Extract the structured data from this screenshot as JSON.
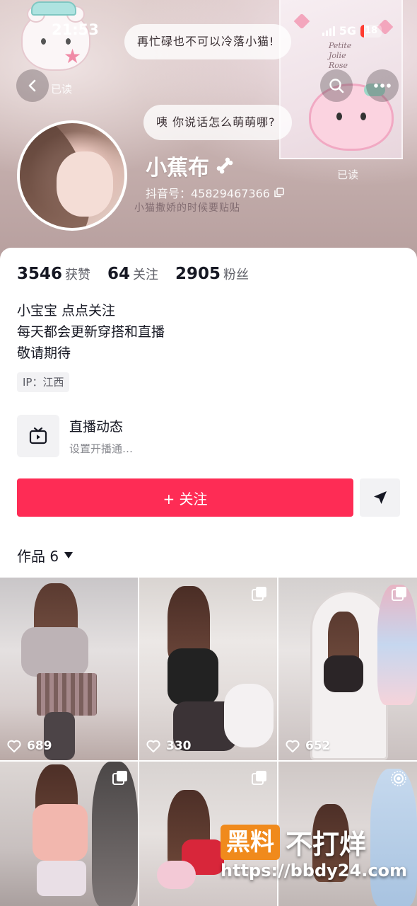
{
  "status_bar": {
    "time": "21:53",
    "network": "5G",
    "battery": "18",
    "battery_level": 0.18,
    "battery_color": "#ff3b30"
  },
  "banner": {
    "bubble_top": "再忙碌也不可以冷落小猫!",
    "bubble_bottom": "咦 你说话怎么萌萌哪?",
    "read_label_left": "已读",
    "read_label_right": "已读",
    "sticker_text": "小猫撒娇的时候要贴贴",
    "poster_text": "Petite\nJolie\nRose"
  },
  "nav": {
    "back_icon": "chevron-left-icon",
    "search_icon": "search-icon",
    "more_icon": "more-dots-icon"
  },
  "profile": {
    "nickname": "小蕉布",
    "nickname_icon": "bone-icon",
    "douyin_id": "抖音号：45829467366",
    "copy_icon": "copy-icon"
  },
  "stats": [
    {
      "value": "3546",
      "label": "获赞"
    },
    {
      "value": "64",
      "label": "关注"
    },
    {
      "value": "2905",
      "label": "粉丝"
    }
  ],
  "bio": [
    "小宝宝 点点关注",
    "每天都会更新穿搭和直播",
    "敬请期待"
  ],
  "ip": "IP：江西",
  "live": {
    "title": "直播动态",
    "subtitle": "设置开播通…",
    "icon": "tv-icon"
  },
  "actions": {
    "follow_label": "+ 关注",
    "follow_color": "#fe2c55",
    "share_icon": "send-icon"
  },
  "works": {
    "label": "作品 6"
  },
  "videos": [
    {
      "likes": "689",
      "corner": ""
    },
    {
      "likes": "330",
      "corner": "multi-image-icon"
    },
    {
      "likes": "652",
      "corner": "multi-image-icon"
    },
    {
      "likes": "",
      "corner": "multi-image-icon"
    },
    {
      "likes": "",
      "corner": "multi-image-icon"
    },
    {
      "likes": "",
      "corner": "live-photo-icon"
    }
  ],
  "watermark": {
    "logo": "黑料",
    "text": "不打烊",
    "url": "https://bbdy24.com"
  }
}
